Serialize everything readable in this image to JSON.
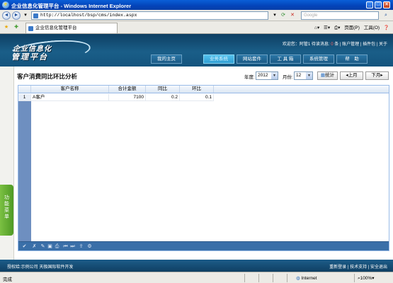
{
  "window": {
    "title": "企业信息化管理平台 - Windows Internet Explorer"
  },
  "address": {
    "url": "http://localhost/bsp/cms/index.aspx",
    "search_placeholder": "Google"
  },
  "tabs": {
    "active_label": "企业信息化管理平台"
  },
  "ie_commands": {
    "page": "页面(P)",
    "tools": "工具(O)",
    "help_icon": "❓"
  },
  "app": {
    "logo_line1": "企业信息化",
    "logo_line2": "管理平台",
    "welcome": "欢迎您：阿管1 待读消息:",
    "unread": "0",
    "unread_suffix": "条",
    "links": [
      "账户管理",
      "插件包",
      "关于"
    ],
    "nav": [
      "我的主页",
      "业务系统",
      "网站套件",
      "工 具 箱",
      "系统管理",
      "帮　助"
    ],
    "active_nav": "业务系统"
  },
  "page": {
    "title": "客户消费同比环比分析",
    "year_label": "年度:",
    "year_value": "2012",
    "month_label": "月份:",
    "month_value": "12",
    "stat_button": "统计",
    "prev_month": "上月",
    "next_month": "下月"
  },
  "sidebar": {
    "toggle_label": "功能菜单"
  },
  "grid": {
    "columns": [
      "客户名称",
      "合计金额",
      "同比",
      "环比"
    ],
    "rows": [
      {
        "num": "1",
        "name": "A客户",
        "total": "7100",
        "yoy": "0.2",
        "mom": "0.1"
      }
    ]
  },
  "footer": {
    "left": "授权给:示例公司  天极国际软件开发",
    "right_links": [
      "重新登录",
      "技术支持",
      "安全退出"
    ]
  },
  "statusbar": {
    "status": "完成",
    "zone": "Internet",
    "zoom": "100%"
  },
  "colors": {
    "header": "#1a5e88",
    "active_nav": "#2f9ed3",
    "sidebar_toggle": "#5aa82c",
    "grid_footer": "#3a6fa8"
  }
}
